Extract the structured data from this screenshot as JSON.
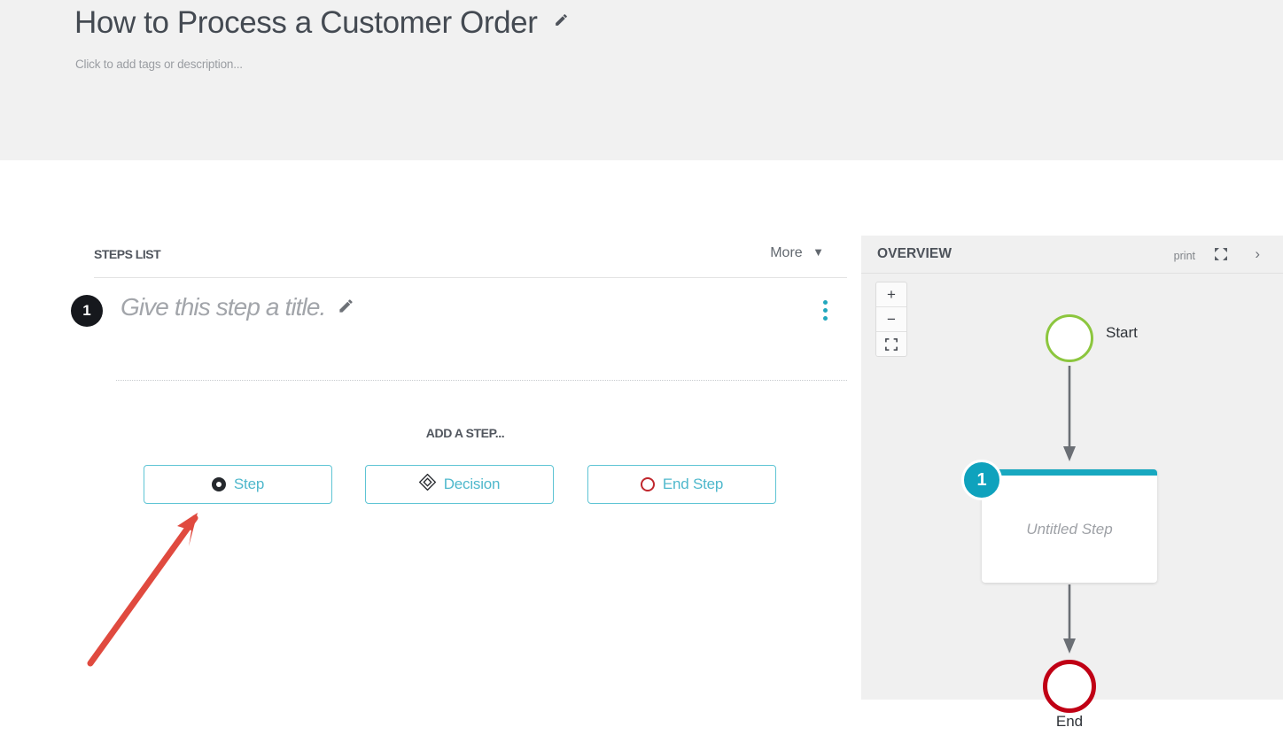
{
  "header": {
    "title": "How to Process a Customer Order",
    "title_edit_icon": "pencil-icon",
    "subtitle": "Click to add tags or description..."
  },
  "steps_panel": {
    "section_title": "STEPS LIST",
    "more_label": "More",
    "more_chevron": "⌄",
    "steps": [
      {
        "number": "1",
        "title": "Give this step a title.",
        "edit_icon": "pencil-icon",
        "menu_icon": "more-vertical-icon"
      }
    ],
    "add_step_label": "ADD A STEP...",
    "add_buttons": [
      {
        "label": "Step",
        "icon": "step-dot-icon"
      },
      {
        "label": "Decision",
        "icon": "decision-diamond-icon"
      },
      {
        "label": "End Step",
        "icon": "end-circle-icon"
      }
    ]
  },
  "overview": {
    "title": "OVERVIEW",
    "print_label": "print",
    "expand_icon": "fullscreen-icon",
    "collapse_icon": "chevron-right-icon",
    "zoom_controls": [
      {
        "label": "+",
        "name": "zoom-in"
      },
      {
        "label": "−",
        "name": "zoom-out"
      },
      {
        "label": "fit",
        "name": "zoom-fit"
      }
    ],
    "flowchart": {
      "start_label": "Start",
      "step_badge": "1",
      "step_label": "Untitled Step",
      "end_label": "End"
    }
  },
  "annotation": {
    "arrow": "red-arrow-pointing-to-step-button"
  },
  "colors": {
    "teal": "#4fb8cc",
    "teal_dark": "#18a8c0",
    "green": "#8cc63e",
    "red": "#c00015",
    "annotation_red": "#e04a3f",
    "header_band": "#f1f1f1",
    "panel_bg": "#f0f0f0",
    "badge_dark": "#16181d"
  }
}
